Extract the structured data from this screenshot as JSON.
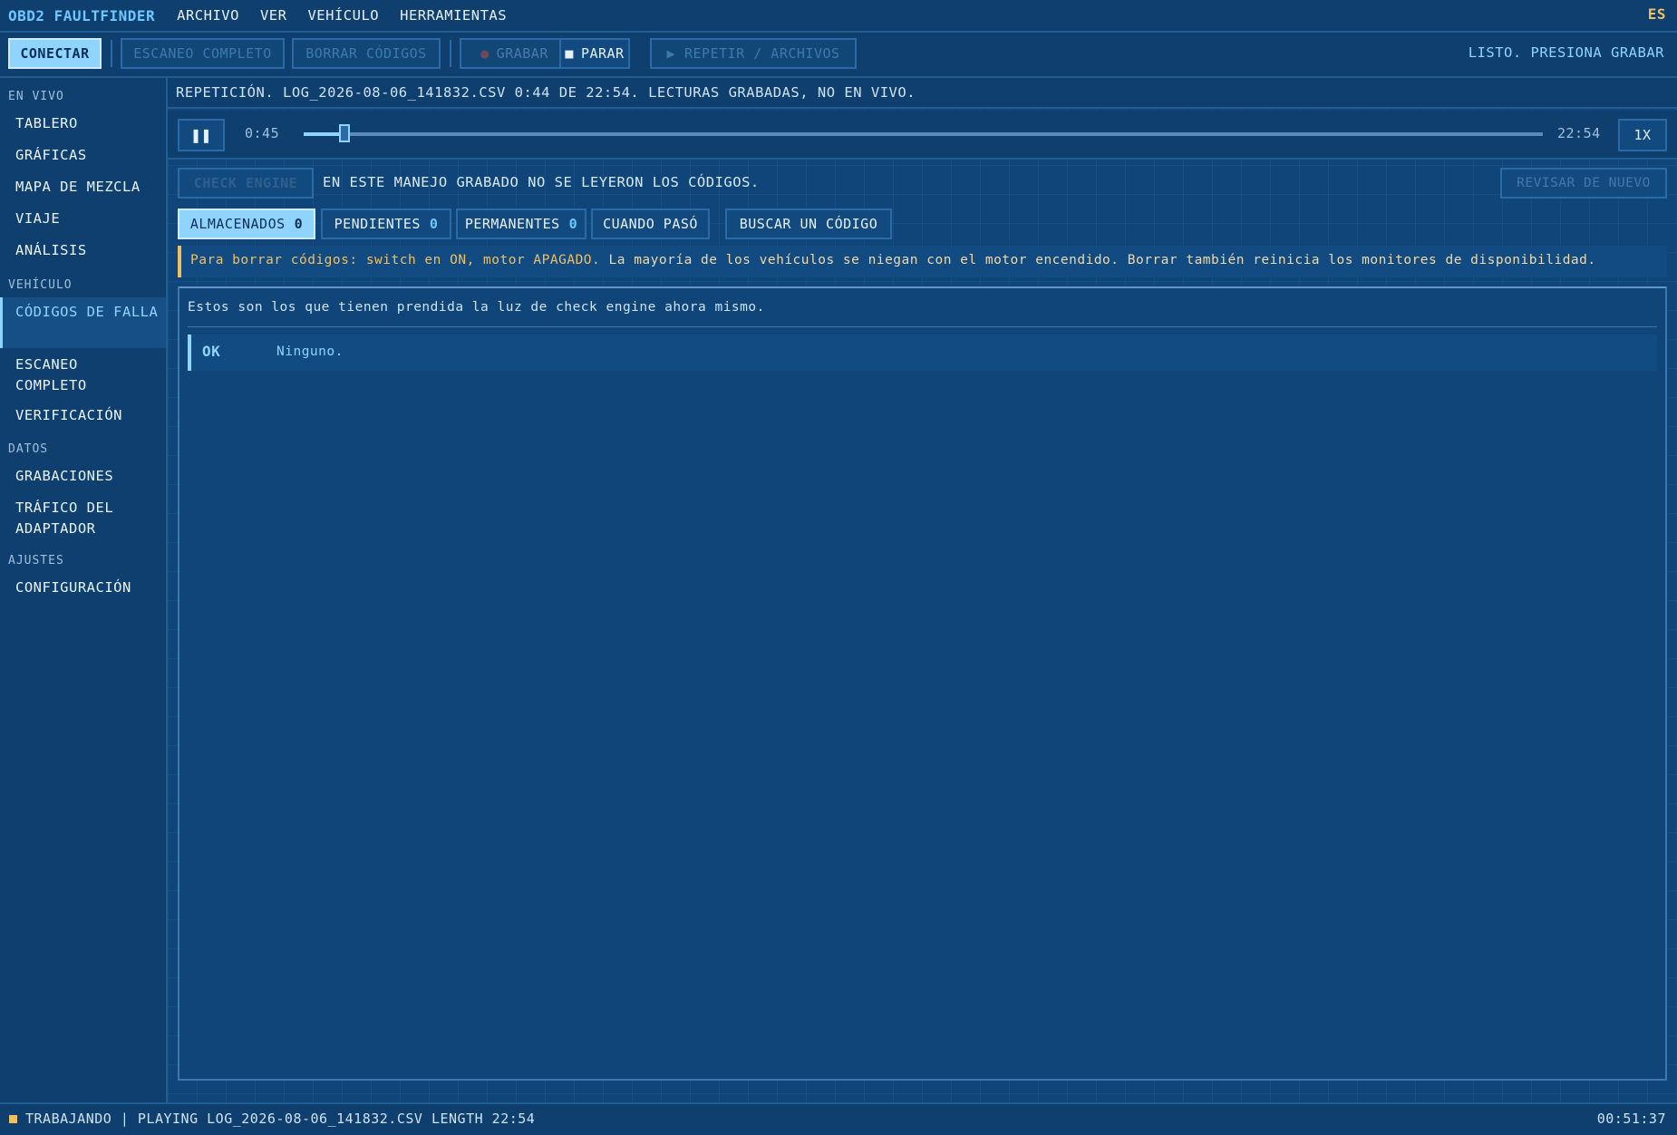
{
  "app": {
    "brand": "OBD2 FAULTFINDER",
    "language": "ES"
  },
  "menu": [
    "ARCHIVO",
    "VER",
    "VEHÍCULO",
    "HERRAMIENTAS"
  ],
  "toolbar": {
    "connect": "CONECTAR",
    "full_scan": "ESCANEO COMPLETO",
    "clear_codes": "BORRAR CÓDIGOS",
    "record": "GRABAR",
    "stop": "PARAR",
    "replay": "REPETIR / ARCHIVOS",
    "status": "LISTO. PRESIONA GRABAR"
  },
  "sidebar": {
    "sections": [
      {
        "title": "EN VIVO",
        "items": [
          "TABLERO",
          "GRÁFICAS",
          "MAPA DE MEZCLA",
          "VIAJE",
          "ANÁLISIS"
        ]
      },
      {
        "title": "VEHÍCULO",
        "items": [
          "CÓDIGOS DE FALLA",
          "ESCANEO COMPLETO",
          "VERIFICACIÓN"
        ]
      },
      {
        "title": "DATOS",
        "items": [
          "GRABACIONES",
          "TRÁFICO DEL ADAPTADOR"
        ]
      },
      {
        "title": "AJUSTES",
        "items": [
          "CONFIGURACIÓN"
        ]
      }
    ],
    "active": "CÓDIGOS DE FALLA"
  },
  "replay": {
    "banner": "REPETICIÓN. LOG_2026-08-06_141832.CSV 0:44 DE 22:54. LECTURAS GRABADAS, NO EN VIVO.",
    "current_time": "0:45",
    "total_time": "22:54",
    "progress_fraction": 0.033,
    "speed": "1X"
  },
  "dtc": {
    "check_engine": "CHECK ENGINE",
    "message": "EN ESTE MANEJO GRABADO NO SE LEYERON LOS CÓDIGOS.",
    "recheck": "REVISAR DE NUEVO",
    "tabs": [
      {
        "label": "ALMACENADOS",
        "count": "0"
      },
      {
        "label": "PENDIENTES",
        "count": "0"
      },
      {
        "label": "PERMANENTES",
        "count": "0"
      },
      {
        "label": "CUANDO PASÓ",
        "count": ""
      },
      {
        "label": "BUSCAR UN CÓDIGO",
        "count": ""
      }
    ],
    "warning_prefix": "Para borrar códigos: switch en ON, motor APAGADO.",
    "warning_text": "La mayoría de los vehículos se niegan con el motor encendido. Borrar también reinicia los monitores de disponibilidad.",
    "panel_desc": "Estos son los que tienen prendida la luz de check engine ahora mismo.",
    "row_status": "OK",
    "row_text": "Ninguno."
  },
  "statusbar": {
    "text": "TRABAJANDO | PLAYING LOG_2026-08-06_141832.CSV LENGTH 22:54",
    "clock": "00:51:37"
  },
  "colors": {
    "background": "#0f4578",
    "accent": "#8fd4ff",
    "warning": "#f0c060"
  }
}
